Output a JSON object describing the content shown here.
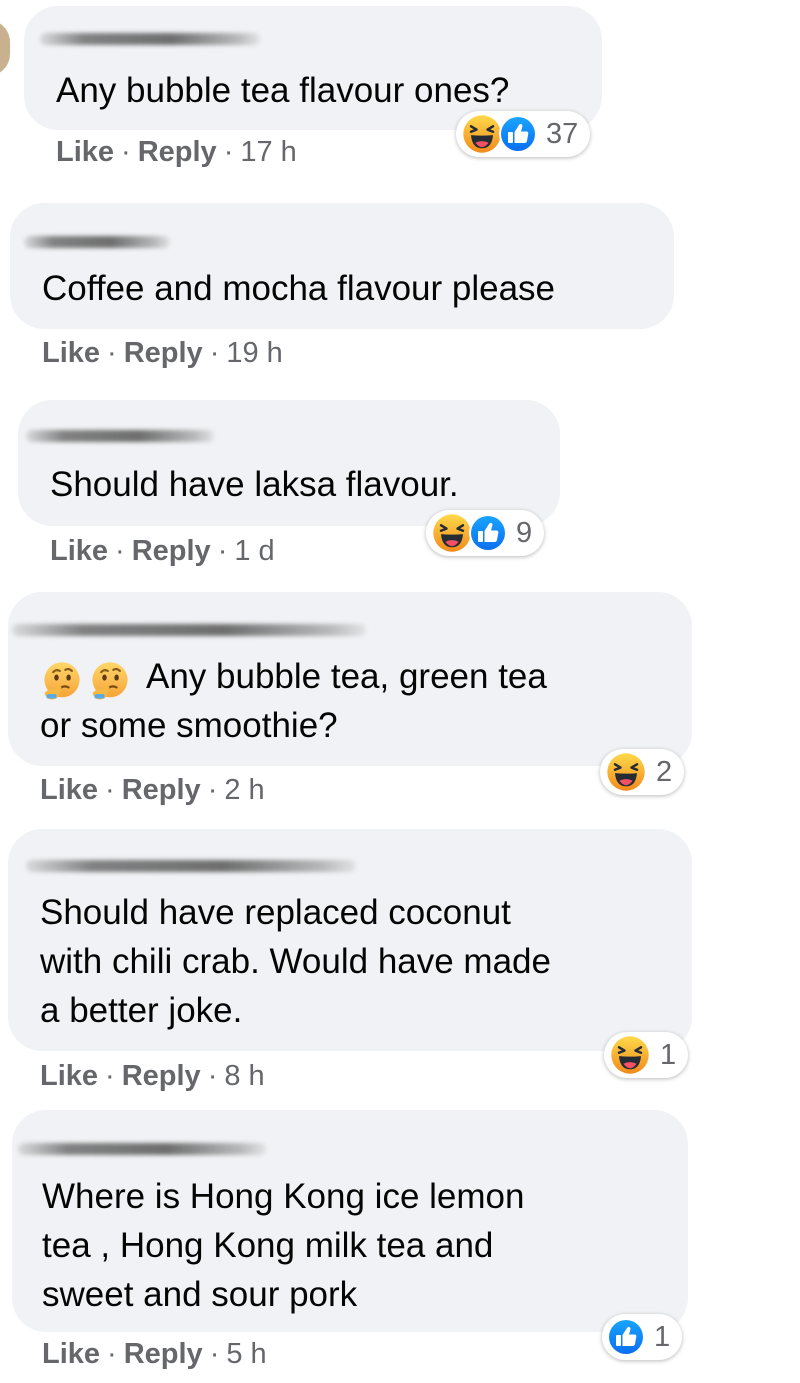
{
  "comments": [
    {
      "text_lines": [
        "Any bubble tea flavour ones?"
      ],
      "like": "Like",
      "reply": "Reply",
      "time": "17 h",
      "reactions": {
        "icons": [
          "haha",
          "like"
        ],
        "count": "37"
      }
    },
    {
      "text_lines": [
        "Coffee and mocha flavour please"
      ],
      "like": "Like",
      "reply": "Reply",
      "time": "19 h",
      "reactions": null
    },
    {
      "text_lines": [
        "Should have laksa flavour."
      ],
      "like": "Like",
      "reply": "Reply",
      "time": "1 d",
      "reactions": {
        "icons": [
          "haha",
          "like"
        ],
        "count": "9"
      }
    },
    {
      "text_lines": [
        "Any bubble tea, green tea",
        "or some smoothie?"
      ],
      "leading_emoji": [
        "thinking-face",
        "thinking-face"
      ],
      "like": "Like",
      "reply": "Reply",
      "time": "2 h",
      "reactions": {
        "icons": [
          "haha"
        ],
        "count": "2"
      }
    },
    {
      "text_lines": [
        "Should have replaced coconut",
        "with chili crab. Would have made",
        "a better joke."
      ],
      "like": "Like",
      "reply": "Reply",
      "time": "8 h",
      "reactions": {
        "icons": [
          "haha"
        ],
        "count": "1"
      }
    },
    {
      "text_lines": [
        "Where is Hong Kong ice lemon",
        "tea , Hong Kong milk tea and",
        "sweet and sour pork"
      ],
      "like": "Like",
      "reply": "Reply",
      "time": "5 h",
      "reactions": {
        "icons": [
          "like"
        ],
        "count": "1"
      }
    }
  ],
  "separator": "·",
  "colors": {
    "bubble_bg": "#f0f2f5",
    "meta_text": "#65676b",
    "like_blue": "#1877f2",
    "haha_yellow": "#f7b125"
  }
}
